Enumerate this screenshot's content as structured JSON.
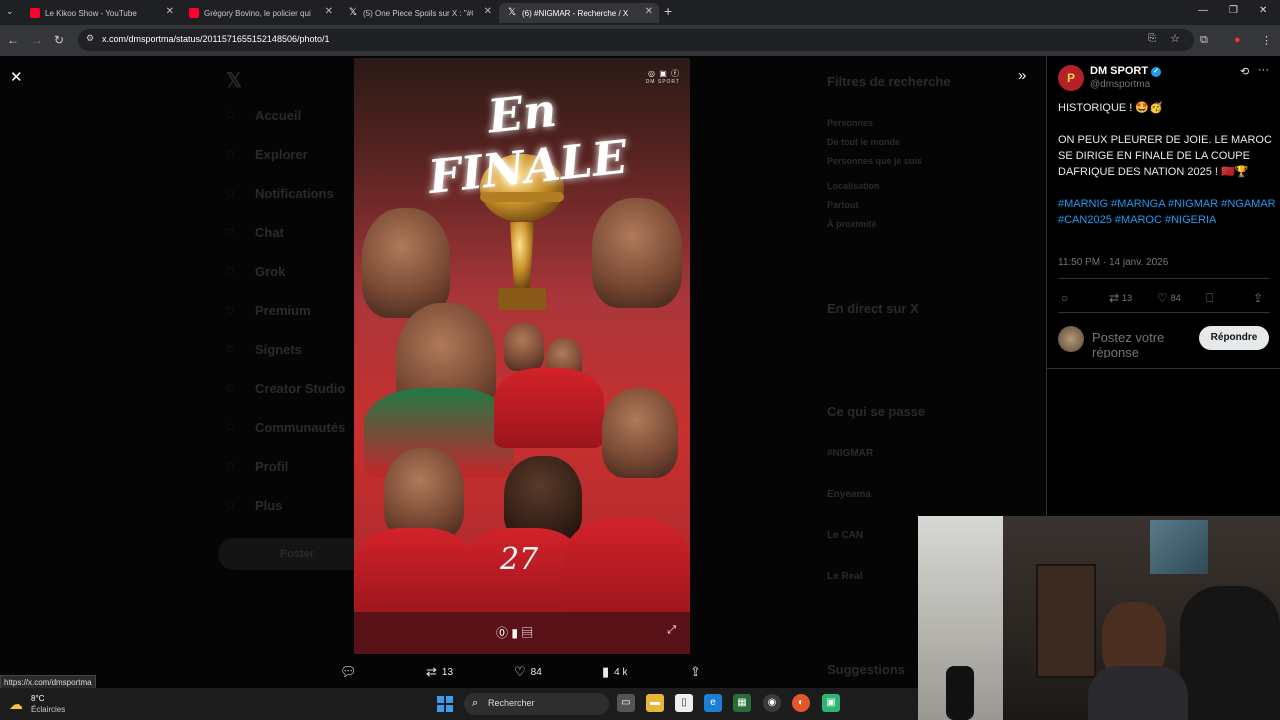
{
  "browser": {
    "tabs": [
      {
        "title": "Le Kikoo Show - YouTube",
        "favicon": "youtube-icon",
        "active": false
      },
      {
        "title": "Grégory Bovino, le policier qui",
        "favicon": "youtube-icon",
        "active": false
      },
      {
        "title": "(5) One Piece Spoils sur X : \"#O",
        "favicon": "x-icon",
        "active": false
      },
      {
        "title": "(6) #NIGMAR - Recherche / X",
        "favicon": "x-icon",
        "active": true
      }
    ],
    "new_tab": "+",
    "url": "x.com/dmsportma/status/2011571655152148506/photo/1"
  },
  "background_sidebar": [
    "Accueil",
    "Explorer",
    "Notifications",
    "Chat",
    "Grok",
    "Premium",
    "Signets",
    "Creator Studio",
    "Communautés",
    "Profil",
    "Plus"
  ],
  "background_post_button": "Poster",
  "background_right": {
    "filters_title": "Filtres de recherche",
    "filters": [
      "Personnes",
      "De tout le monde",
      "Personnes que je suis",
      "Localisation",
      "Partout",
      "À proximité"
    ],
    "live_title": "En direct sur X",
    "trends_title": "Ce qui se passe",
    "trends": [
      "#NIGMAR",
      "Enyeama",
      "Le CAN",
      "Le Real"
    ],
    "suggestions_title": "Suggestions"
  },
  "poster": {
    "headline": "En FINALE",
    "brand": "DM SPORT",
    "social": "◎ ▣ ⓕ",
    "jersey_number": "27"
  },
  "media_actions": {
    "replies": "",
    "reposts": "13",
    "likes": "84",
    "views": "4 k"
  },
  "post": {
    "display_name": "DM SPORT",
    "handle": "@dmsportma",
    "line1": "HISTORIQUE ! 🤩🥳",
    "line2": "ON PEUX PLEURER DE JOIE. LE MAROC SE DIRIGE EN FINALE DE LA COUPE DAFRIQUE DES NATION 2025 ! 🇲🇦🏆",
    "hashtags": "#MARNIG #MARNGA #NIGMAR #NGAMAR #CAN2025 #MAROC #NIGERIA",
    "timestamp": "11:50 PM · 14 janv. 2026",
    "reposts": "13",
    "likes": "84",
    "reply_placeholder": "Postez votre réponse",
    "reply_button": "Répondre"
  },
  "status_bar_url": "https://x.com/dmsportma",
  "taskbar": {
    "temperature": "8°C",
    "weather": "Éclaircies",
    "search_label": "Rechercher"
  }
}
